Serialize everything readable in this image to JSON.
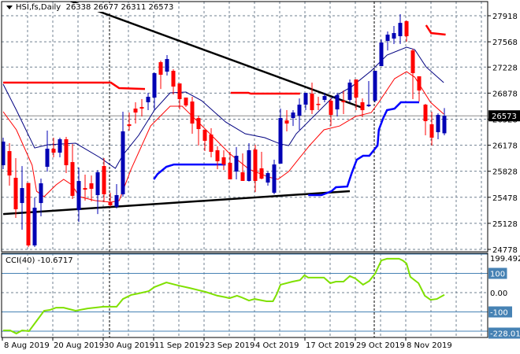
{
  "header": {
    "symbol": "HSI,fs,Daily",
    "ohlc": "26338 26677 26311 26573"
  },
  "current_price": "26573",
  "colors": {
    "bull": "#0000b4",
    "bear": "#ff0000",
    "ma_fast": "#000080",
    "ma_slow": "#ff0000",
    "resistance": "#ff0000",
    "support": "#0000ff",
    "trend": "#000000",
    "cci": "#7fe000",
    "level": "#4682b4",
    "grid": "#708090"
  },
  "price_axis": [
    "27918",
    "27568",
    "27228",
    "26878",
    "26528",
    "26178",
    "25828",
    "25478",
    "25128",
    "24778"
  ],
  "price_range": [
    24778,
    27918
  ],
  "date_labels": [
    {
      "label": "8 Aug 2019",
      "index": 0
    },
    {
      "label": "20 Aug 2019",
      "index": 8
    },
    {
      "label": "30 Aug 2019",
      "index": 16
    },
    {
      "label": "11 Sep 2019",
      "index": 24
    },
    {
      "label": "23 Sep 2019",
      "index": 32
    },
    {
      "label": "4 Oct 2019",
      "index": 40
    },
    {
      "label": "17 Oct 2019",
      "index": 48
    },
    {
      "label": "29 Oct 2019",
      "index": 56
    },
    {
      "label": "8 Nov 2019",
      "index": 64
    }
  ],
  "period_separators": [
    17,
    59
  ],
  "candles": [
    [
      25909,
      26279,
      25856,
      26226
    ],
    [
      26099,
      26205,
      25634,
      25771
    ],
    [
      25740,
      26004,
      25201,
      25317
    ],
    [
      25401,
      25898,
      25042,
      25602
    ],
    [
      25670,
      25670,
      24810,
      24831
    ],
    [
      24831,
      25475,
      24810,
      25338
    ],
    [
      25401,
      25729,
      25222,
      25666
    ],
    [
      25888,
      26374,
      25824,
      26131
    ],
    [
      26131,
      26279,
      26015,
      26078
    ],
    [
      26078,
      26279,
      26015,
      26258
    ],
    [
      26258,
      26290,
      25803,
      25909
    ],
    [
      25951,
      26194,
      25454,
      25497
    ],
    [
      25306,
      25877,
      25148,
      25697
    ],
    [
      25602,
      25782,
      25433,
      25581
    ],
    [
      25666,
      25771,
      25423,
      25592
    ],
    [
      25507,
      25845,
      25253,
      25814
    ],
    [
      25898,
      26004,
      25412,
      25518
    ],
    [
      25412,
      25539,
      25350,
      25370
    ],
    [
      25350,
      25655,
      25328,
      25507
    ],
    [
      25518,
      26628,
      25486,
      26364
    ],
    [
      26459,
      26617,
      26374,
      26437
    ],
    [
      26670,
      26755,
      26469,
      26617
    ],
    [
      26691,
      26797,
      26564,
      26670
    ],
    [
      26755,
      26882,
      26649,
      26829
    ],
    [
      26818,
      27156,
      26649,
      27146
    ],
    [
      27294,
      27315,
      26934,
      27125
    ],
    [
      27167,
      27389,
      27114,
      27336
    ],
    [
      27178,
      27199,
      26860,
      26966
    ],
    [
      27008,
      27008,
      26659,
      26797
    ],
    [
      26818,
      26818,
      26691,
      26712
    ],
    [
      26765,
      26829,
      26332,
      26469
    ],
    [
      26543,
      26575,
      26173,
      26395
    ],
    [
      26385,
      26385,
      26099,
      26237
    ],
    [
      26321,
      26406,
      26015,
      26089
    ],
    [
      26110,
      26163,
      25856,
      25962
    ],
    [
      26015,
      26110,
      25845,
      25919
    ],
    [
      25941,
      26089,
      25719,
      25719
    ],
    [
      25824,
      26152,
      25719,
      26036
    ],
    [
      25814,
      26068,
      25698,
      25698
    ],
    [
      25698,
      26205,
      25690,
      26110
    ],
    [
      26120,
      26184,
      25549,
      25698
    ],
    [
      25867,
      26089,
      25719,
      25729
    ],
    [
      25676,
      25824,
      25634,
      25803
    ],
    [
      25539,
      25983,
      25518,
      25919
    ],
    [
      25930,
      26670,
      25930,
      26543
    ],
    [
      26511,
      26649,
      26364,
      26469
    ],
    [
      26543,
      26649,
      26437,
      26617
    ],
    [
      26575,
      26807,
      26385,
      26723
    ],
    [
      26723,
      26882,
      26649,
      26882
    ],
    [
      26871,
      27019,
      26596,
      26649
    ],
    [
      26734,
      26829,
      26649,
      26725
    ],
    [
      26787,
      26882,
      26755,
      26839
    ],
    [
      26776,
      26807,
      26437,
      26585
    ],
    [
      26659,
      26882,
      26564,
      26850
    ],
    [
      26776,
      26913,
      26596,
      26755
    ],
    [
      26787,
      27061,
      26755,
      27019
    ],
    [
      27061,
      27061,
      26649,
      26818
    ],
    [
      26755,
      26807,
      26554,
      26649
    ],
    [
      26702,
      27040,
      26691,
      26723
    ],
    [
      26776,
      27178,
      26755,
      27178
    ],
    [
      27241,
      27600,
      27241,
      27558
    ],
    [
      27579,
      27706,
      27452,
      27664
    ],
    [
      27611,
      27780,
      27537,
      27685
    ],
    [
      27643,
      27939,
      27537,
      27822
    ],
    [
      27844,
      27854,
      27569,
      27643
    ],
    [
      27452,
      27473,
      26797,
      27146
    ],
    [
      27104,
      27104,
      26765,
      26913
    ],
    [
      26723,
      26734,
      26311,
      26501
    ],
    [
      26459,
      26628,
      26173,
      26279
    ],
    [
      26353,
      26607,
      26258,
      26585
    ],
    [
      26338,
      26677,
      26311,
      26573
    ]
  ],
  "ma_fast": [
    [
      0,
      26998
    ],
    [
      2.1,
      26649
    ],
    [
      5,
      26141
    ],
    [
      7.1,
      26184
    ],
    [
      11.5,
      26205
    ],
    [
      15.3,
      26015
    ],
    [
      17.8,
      25867
    ],
    [
      19,
      26046
    ],
    [
      21.5,
      26311
    ],
    [
      24,
      26649
    ],
    [
      26.5,
      26882
    ],
    [
      29,
      26892
    ],
    [
      31.5,
      26776
    ],
    [
      35.3,
      26490
    ],
    [
      38.4,
      26332
    ],
    [
      41.5,
      26279
    ],
    [
      44,
      26194
    ],
    [
      45.3,
      26173
    ],
    [
      46.5,
      26332
    ],
    [
      49,
      26543
    ],
    [
      52.1,
      26807
    ],
    [
      55.3,
      26966
    ],
    [
      58.4,
      27178
    ],
    [
      60.9,
      27389
    ],
    [
      64,
      27495
    ],
    [
      65.3,
      27463
    ],
    [
      67.1,
      27230
    ],
    [
      69.9,
      27019
    ]
  ],
  "ma_slow": [
    [
      0,
      26628
    ],
    [
      2.1,
      26385
    ],
    [
      4.6,
      25909
    ],
    [
      5.3,
      25560
    ],
    [
      6.5,
      25486
    ],
    [
      8.4,
      25645
    ],
    [
      9.6,
      25719
    ],
    [
      10.9,
      25645
    ],
    [
      12.1,
      25486
    ],
    [
      14.6,
      25433
    ],
    [
      17.1,
      25412
    ],
    [
      18.4,
      25433
    ],
    [
      20.3,
      25856
    ],
    [
      23.4,
      26437
    ],
    [
      26.5,
      26702
    ],
    [
      28.4,
      26702
    ],
    [
      30.3,
      26543
    ],
    [
      32.8,
      26332
    ],
    [
      35.9,
      26068
    ],
    [
      39,
      25856
    ],
    [
      42.1,
      25750
    ],
    [
      43.6,
      25719
    ],
    [
      45.3,
      25824
    ],
    [
      47.1,
      26015
    ],
    [
      48.6,
      26173
    ],
    [
      50.9,
      26385
    ],
    [
      53.4,
      26437
    ],
    [
      55.9,
      26564
    ],
    [
      58.4,
      26617
    ],
    [
      59.6,
      26755
    ],
    [
      62.1,
      27072
    ],
    [
      64,
      27167
    ],
    [
      65.3,
      27093
    ],
    [
      67.8,
      26755
    ],
    [
      69.9,
      26596
    ]
  ],
  "resistance": [
    [
      [
        0,
        27019
      ],
      [
        17.1,
        27019
      ],
      [
        18.4,
        26945
      ],
      [
        22.5,
        26934
      ]
    ],
    [
      [
        36.1,
        26882
      ],
      [
        38.9,
        26882
      ],
      [
        39.3,
        26871
      ],
      [
        47.1,
        26871
      ]
    ],
    [
      [
        67.1,
        27791
      ],
      [
        67.9,
        27685
      ],
      [
        70.2,
        27664
      ]
    ]
  ],
  "support": [
    [
      [
        23.9,
        25719
      ],
      [
        24.5,
        25790
      ],
      [
        25.9,
        25888
      ],
      [
        27.1,
        25919
      ],
      [
        35.3,
        25919
      ]
    ],
    [
      [
        48.4,
        25507
      ],
      [
        50.5,
        25507
      ],
      [
        52.1,
        25560
      ],
      [
        52.8,
        25613
      ],
      [
        54.6,
        25623
      ],
      [
        55.3,
        25803
      ],
      [
        56.1,
        25983
      ],
      [
        57.1,
        26036
      ],
      [
        58.1,
        26036
      ],
      [
        59.4,
        26173
      ],
      [
        59.6,
        26385
      ],
      [
        60.3,
        26543
      ],
      [
        60.9,
        26649
      ],
      [
        62.1,
        26670
      ],
      [
        63.1,
        26755
      ],
      [
        66,
        26755
      ]
    ]
  ],
  "trendlines": [
    [
      [
        10.25,
        28129
      ],
      [
        57,
        26681
      ]
    ],
    [
      [
        0,
        25253
      ],
      [
        55,
        25560
      ]
    ]
  ],
  "cci": {
    "label": "CCI(40) -10.6717",
    "axis_top": "199.492",
    "axis_bottom": "-228.012",
    "levels": [
      "100",
      "0.00",
      "-100"
    ],
    "range": [
      -228.012,
      199.492
    ],
    "values": [
      [
        0,
        -196
      ],
      [
        1.1,
        -196
      ],
      [
        2.1,
        -212
      ],
      [
        3,
        -196
      ],
      [
        4.1,
        -200
      ],
      [
        5.3,
        -147
      ],
      [
        6.5,
        -94
      ],
      [
        7.4,
        -90
      ],
      [
        8.4,
        -78
      ],
      [
        9.6,
        -78
      ],
      [
        11.5,
        -94
      ],
      [
        13.4,
        -82
      ],
      [
        15.9,
        -73
      ],
      [
        18,
        -73
      ],
      [
        19,
        -33
      ],
      [
        20.3,
        -12
      ],
      [
        21.5,
        -4
      ],
      [
        23.1,
        8
      ],
      [
        24,
        29
      ],
      [
        25.9,
        53
      ],
      [
        27.8,
        37
      ],
      [
        29.6,
        24
      ],
      [
        32.1,
        4
      ],
      [
        34,
        -16
      ],
      [
        35.3,
        -24
      ],
      [
        35.9,
        -29
      ],
      [
        37.1,
        -16
      ],
      [
        37.8,
        -24
      ],
      [
        39,
        -41
      ],
      [
        39.9,
        -33
      ],
      [
        41.8,
        -45
      ],
      [
        42.8,
        -45
      ],
      [
        43.4,
        -8
      ],
      [
        44,
        41
      ],
      [
        45.9,
        57
      ],
      [
        47.1,
        65
      ],
      [
        47.8,
        90
      ],
      [
        48.4,
        78
      ],
      [
        49.6,
        78
      ],
      [
        50.9,
        78
      ],
      [
        51.9,
        49
      ],
      [
        52.8,
        57
      ],
      [
        54,
        57
      ],
      [
        55,
        86
      ],
      [
        55.9,
        73
      ],
      [
        57.1,
        41
      ],
      [
        58.1,
        61
      ],
      [
        59,
        98
      ],
      [
        60,
        167
      ],
      [
        60.9,
        176
      ],
      [
        62.8,
        176
      ],
      [
        63.4,
        167
      ],
      [
        64,
        151
      ],
      [
        64.6,
        82
      ],
      [
        65.9,
        49
      ],
      [
        66.9,
        -16
      ],
      [
        67.8,
        -37
      ],
      [
        68.8,
        -33
      ],
      [
        70,
        -11
      ]
    ]
  }
}
